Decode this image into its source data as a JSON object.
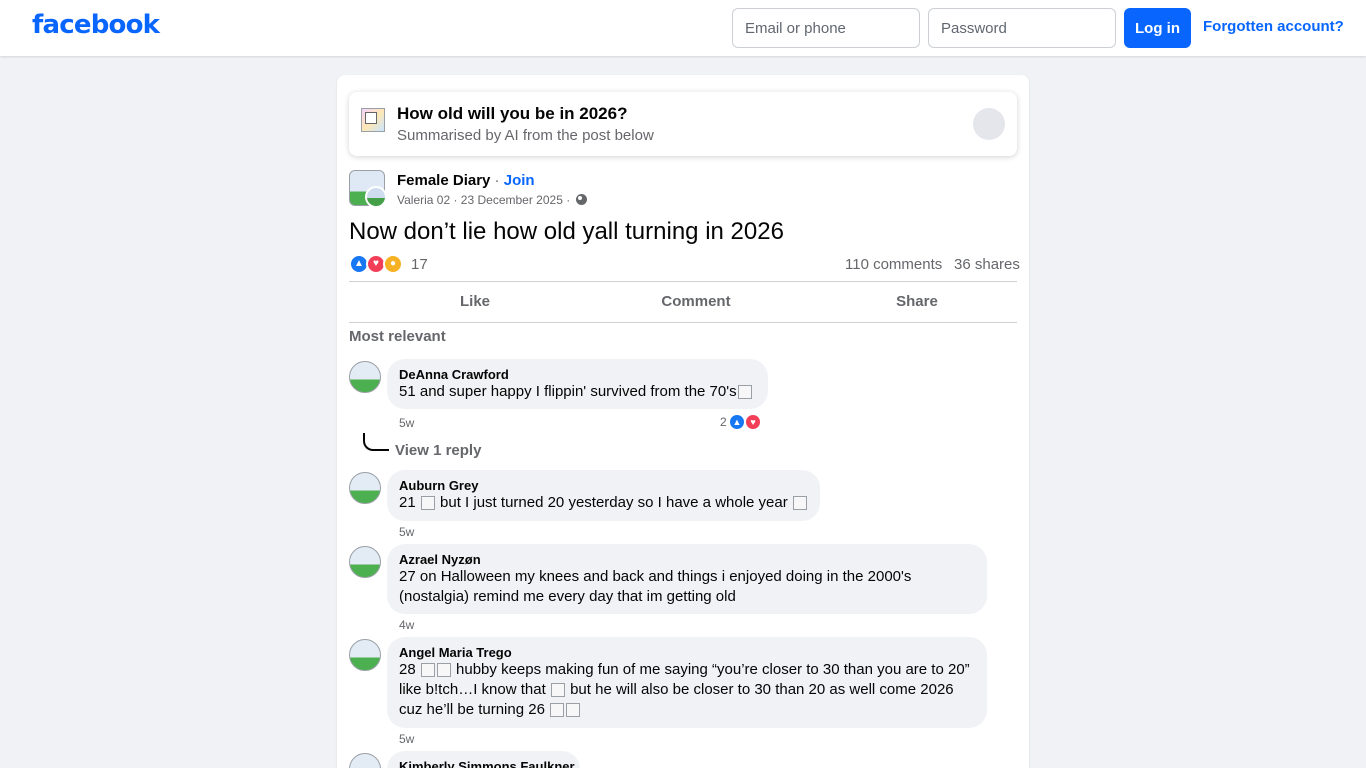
{
  "header": {
    "logo": "facebook",
    "email_placeholder": "Email or phone",
    "password_placeholder": "Password",
    "login_label": "Log in",
    "forgot_label": "Forgotten account?"
  },
  "summary": {
    "title": "How old will you be in 2026?",
    "subtitle": "Summarised by AI from the post below"
  },
  "post": {
    "group": "Female Diary",
    "separator": " · ",
    "join": "Join",
    "meta": "Valeria 02 · 23 December 2025 · ",
    "text": "Now don’t lie how old yall turning in 2026",
    "reaction_count": "17",
    "comments": "110 comments",
    "shares": "36 shares",
    "actions": {
      "like": "Like",
      "comment": "Comment",
      "share": "Share"
    },
    "sort_label": "Most relevant"
  },
  "comments": [
    {
      "name": "DeAnna Crawford",
      "text": "51 and super happy I flippin' survived from the 70's",
      "time": "5w",
      "reactions": "2",
      "reply_label": "View 1 reply"
    },
    {
      "name": "Auburn Grey",
      "text_a": "21",
      "text_b": "but I just turned 20 yesterday so I have a whole year",
      "time": "5w"
    },
    {
      "name": "Azrael Nyzøn",
      "text": "27 on Halloween my knees and back and things i enjoyed doing in the 2000's (nostalgia) remind me every day that im getting old",
      "time": "4w"
    },
    {
      "name": "Angel Maria Trego",
      "text_a": "28",
      "text_b": "hubby keeps making fun of me saying “you’re closer to 30 than you are to 20” like b!tch…I know that",
      "text_c": "but he will also be closer to 30 than 20 as well come 2026 cuz he’ll be turning 26",
      "time": "5w"
    },
    {
      "name": "Kimberly Simmons Faulkner"
    }
  ],
  "colors": {
    "brand": "#0866ff",
    "background": "#f0f2f5",
    "secondary_text": "#65676b",
    "like": "#1877f2",
    "love": "#f33e58",
    "care": "#f7b125"
  },
  "icons": [
    "globe-icon",
    "like-reaction-icon",
    "love-reaction-icon",
    "care-reaction-icon",
    "emoji-image-icon"
  ]
}
